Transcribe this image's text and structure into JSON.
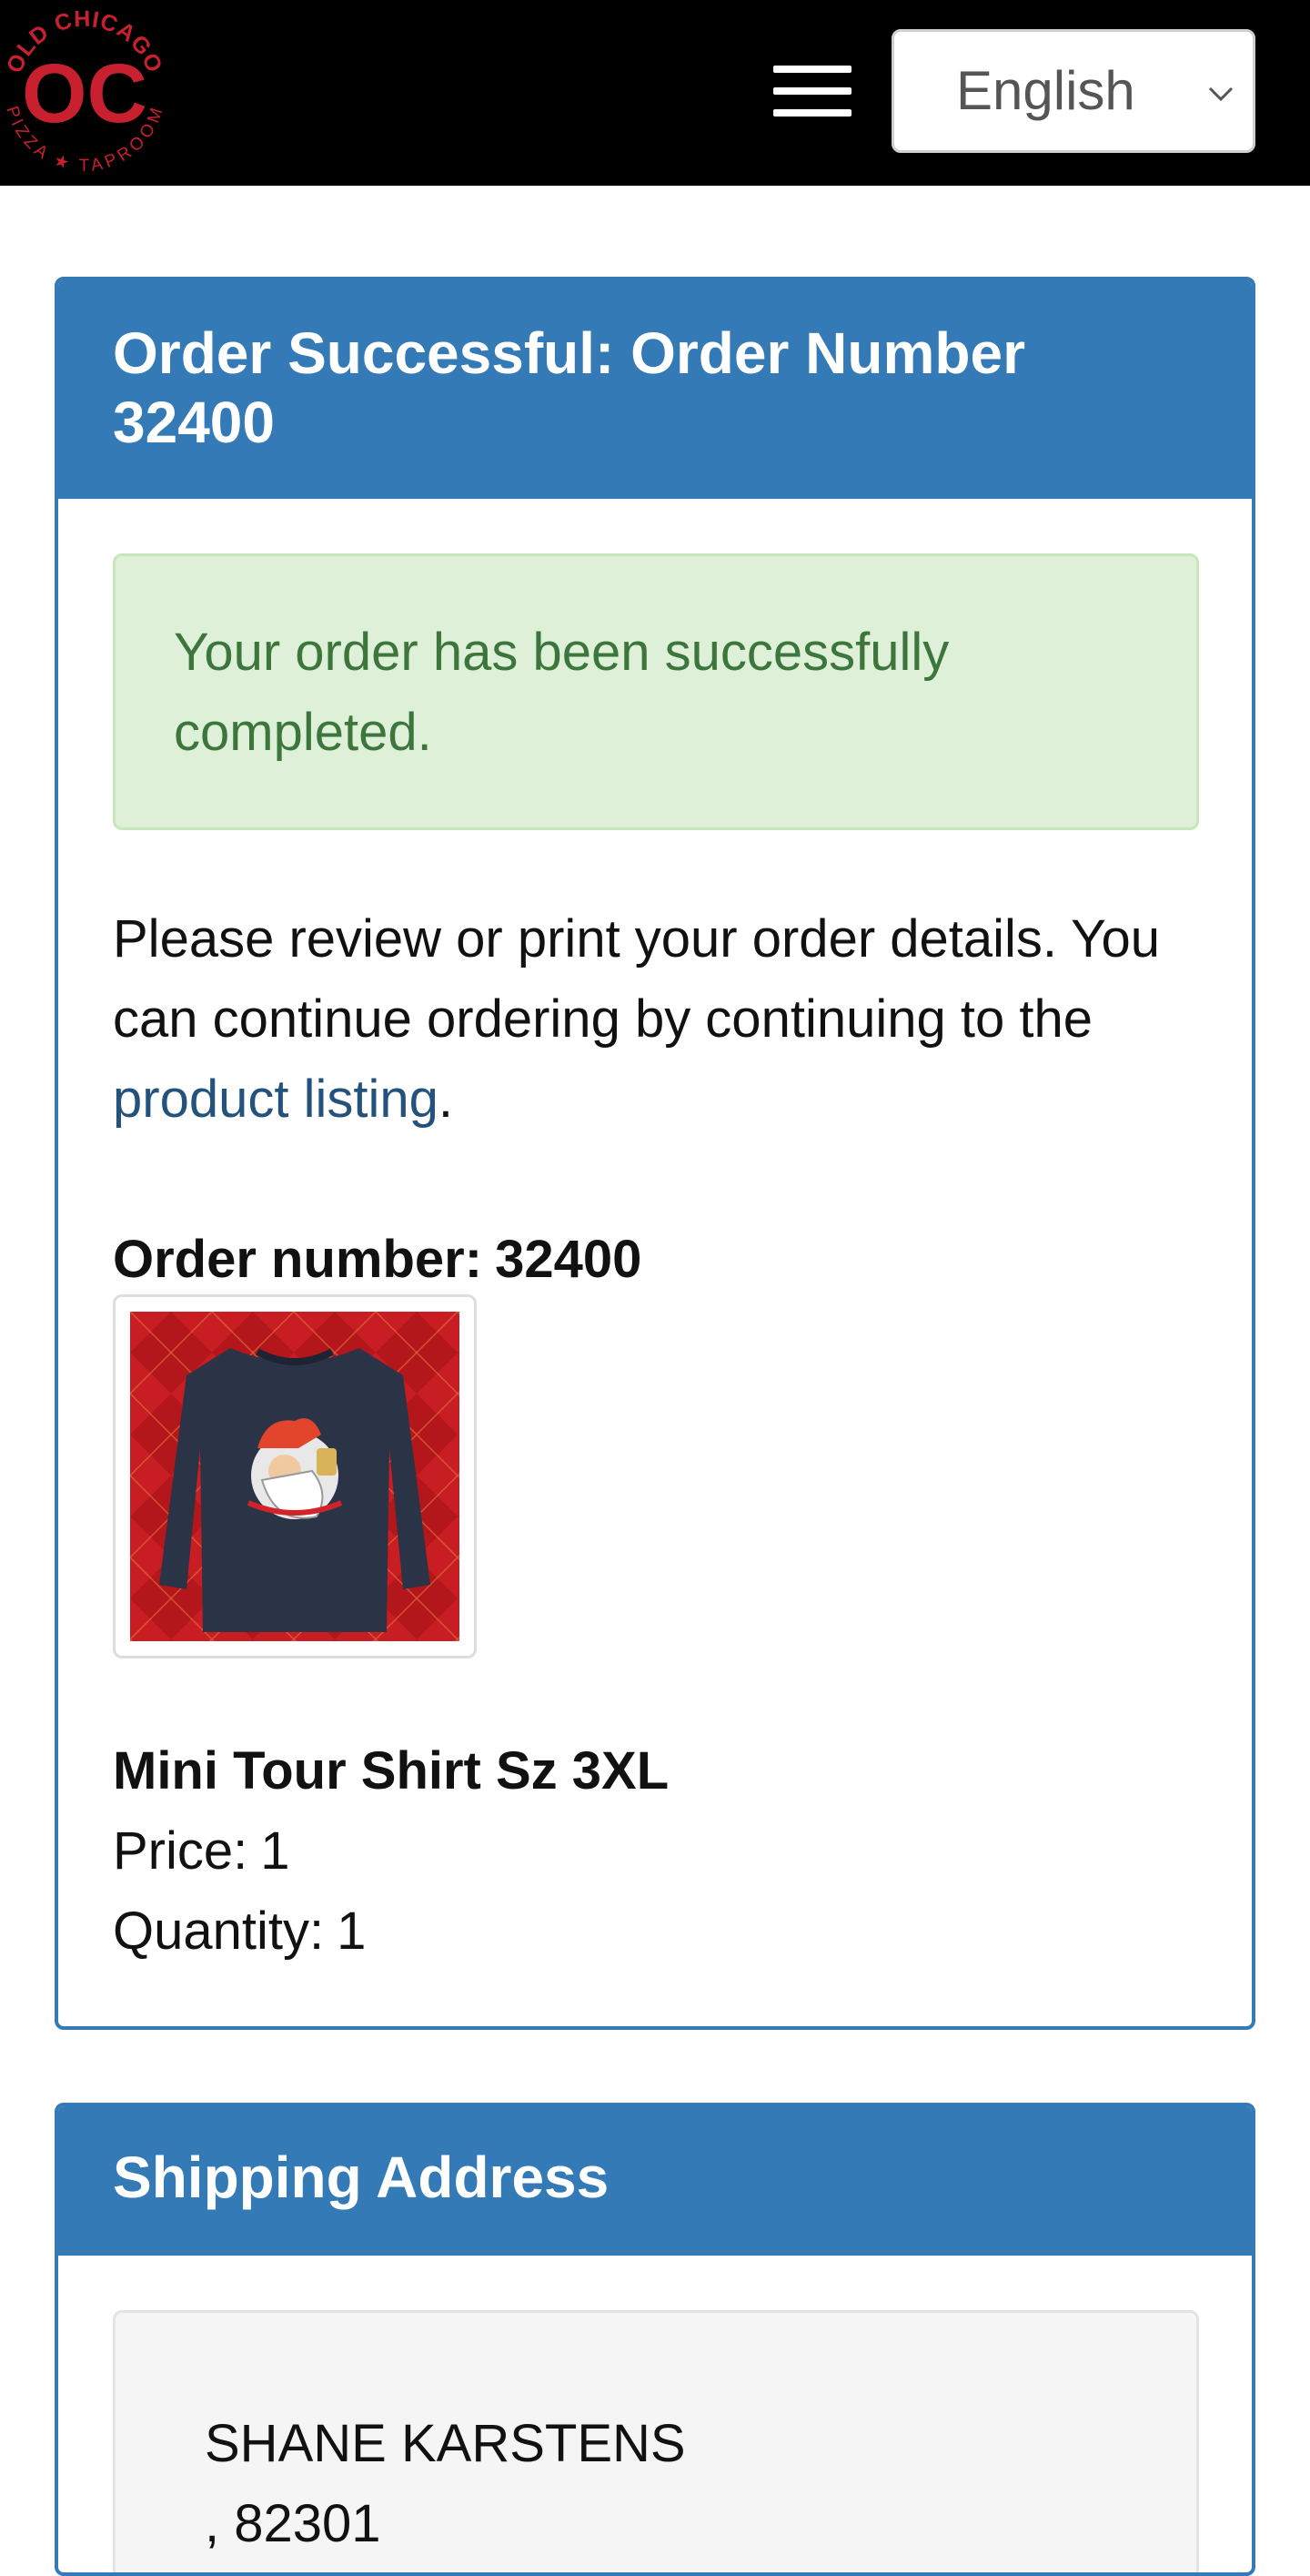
{
  "header": {
    "logo": {
      "arc_top": "OLD CHICAGO",
      "monogram": "OC",
      "arc_bottom": "PIZZA ★ TAPROOM",
      "brand_color": "#c8202f"
    },
    "menu_icon": "hamburger-icon",
    "language": {
      "selected": "English",
      "icon": "chevron-down-icon"
    }
  },
  "order_panel": {
    "title": "Order Successful: Order Number 32400",
    "success_message": "Your order has been successfully completed.",
    "review_text_before": "Please review or print your order details. You can continue ordering by continuing to the ",
    "review_link": "product listing",
    "review_text_after": ".",
    "order_number_label": "Order number:",
    "order_number": "32400",
    "item": {
      "name": "Mini Tour Shirt Sz 3XL",
      "price_label": "Price:",
      "price": "1",
      "quantity_label": "Quantity:",
      "quantity": "1"
    }
  },
  "shipping_panel": {
    "title": "Shipping Address",
    "name": "SHANE KARSTENS",
    "line2": ", 82301"
  },
  "colors": {
    "header_bg": "#000000",
    "panel_primary": "#337ab7",
    "success_bg": "#dff0d8",
    "success_text": "#3c763d",
    "link": "#23527c"
  }
}
